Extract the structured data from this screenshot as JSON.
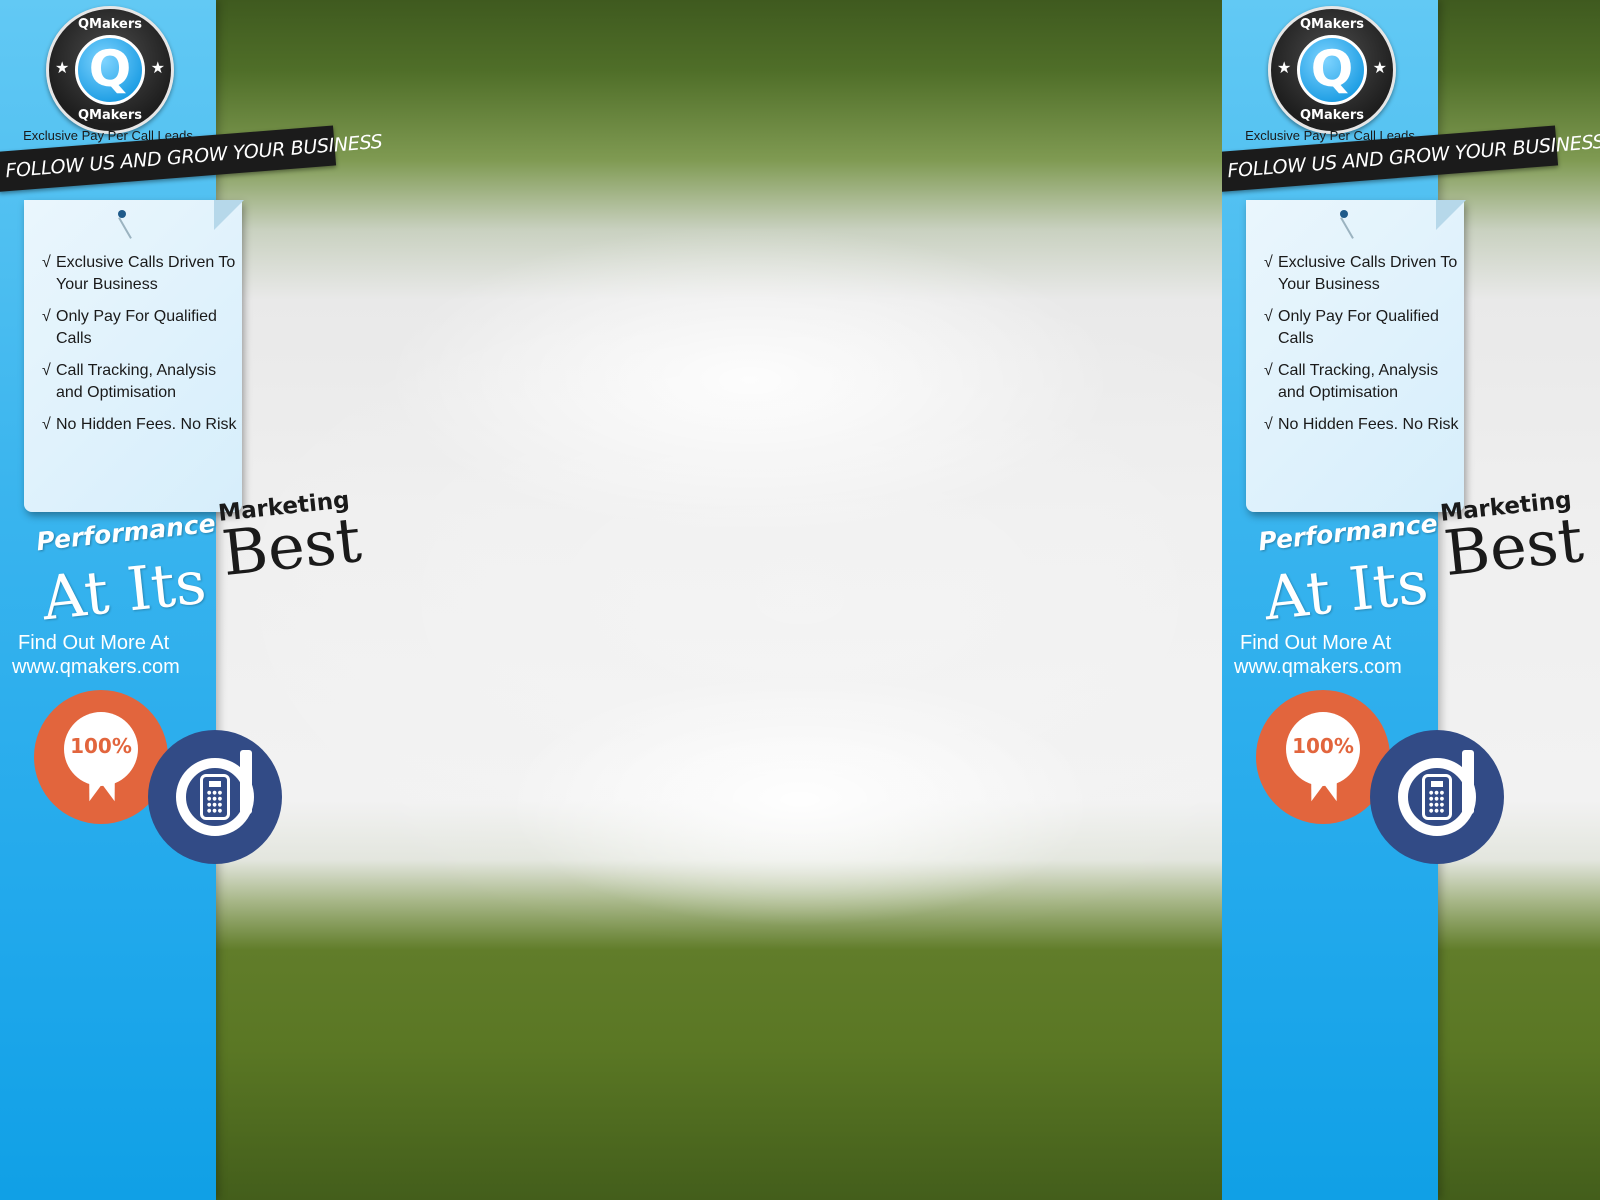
{
  "brand": {
    "name_top": "QMakers",
    "name_bottom": "QMakers",
    "letter": "Q",
    "tagline": "Exclusive Pay Per Call Leads"
  },
  "banner": "FOLLOW US AND GROW YOUR BUSINESS",
  "benefits": [
    "Exclusive Calls Driven To Your Business",
    "Only Pay For Qualified Calls",
    "Call Tracking, Analysis and Optimisation",
    "No Hidden Fees. No Risk"
  ],
  "check_symbol": "√",
  "slogan": {
    "performance": "Performance",
    "at_its": "At Its",
    "marketing": "Marketing",
    "best": "Best"
  },
  "cta": {
    "find_more": "Find Out More At",
    "url": "www.qmakers.com"
  },
  "badges": {
    "guarantee_text": "100%",
    "guarantee_icon": "award-ribbon-icon",
    "phone_icon": "phone-call-icon"
  },
  "colors": {
    "strip": "#22a9ec",
    "badge_orange": "#e2653d",
    "badge_navy": "#324b86",
    "banner": "#1b1b1b"
  }
}
